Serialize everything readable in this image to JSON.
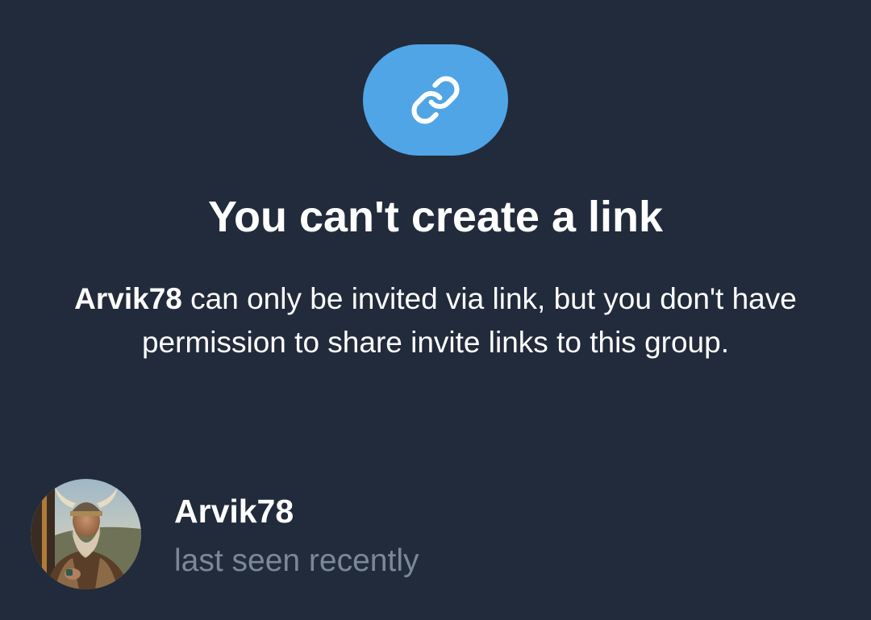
{
  "dialog": {
    "icon": "link-icon",
    "accent_color": "#50a5e6",
    "background_color": "#222b3b",
    "title": "You can't create a link",
    "description_user": "Arvik78",
    "description_text": " can only be invited via link, but you don't have permission to share invite links to this group."
  },
  "user": {
    "name": "Arvik78",
    "status": "last seen recently",
    "avatar": "viking-avatar"
  }
}
